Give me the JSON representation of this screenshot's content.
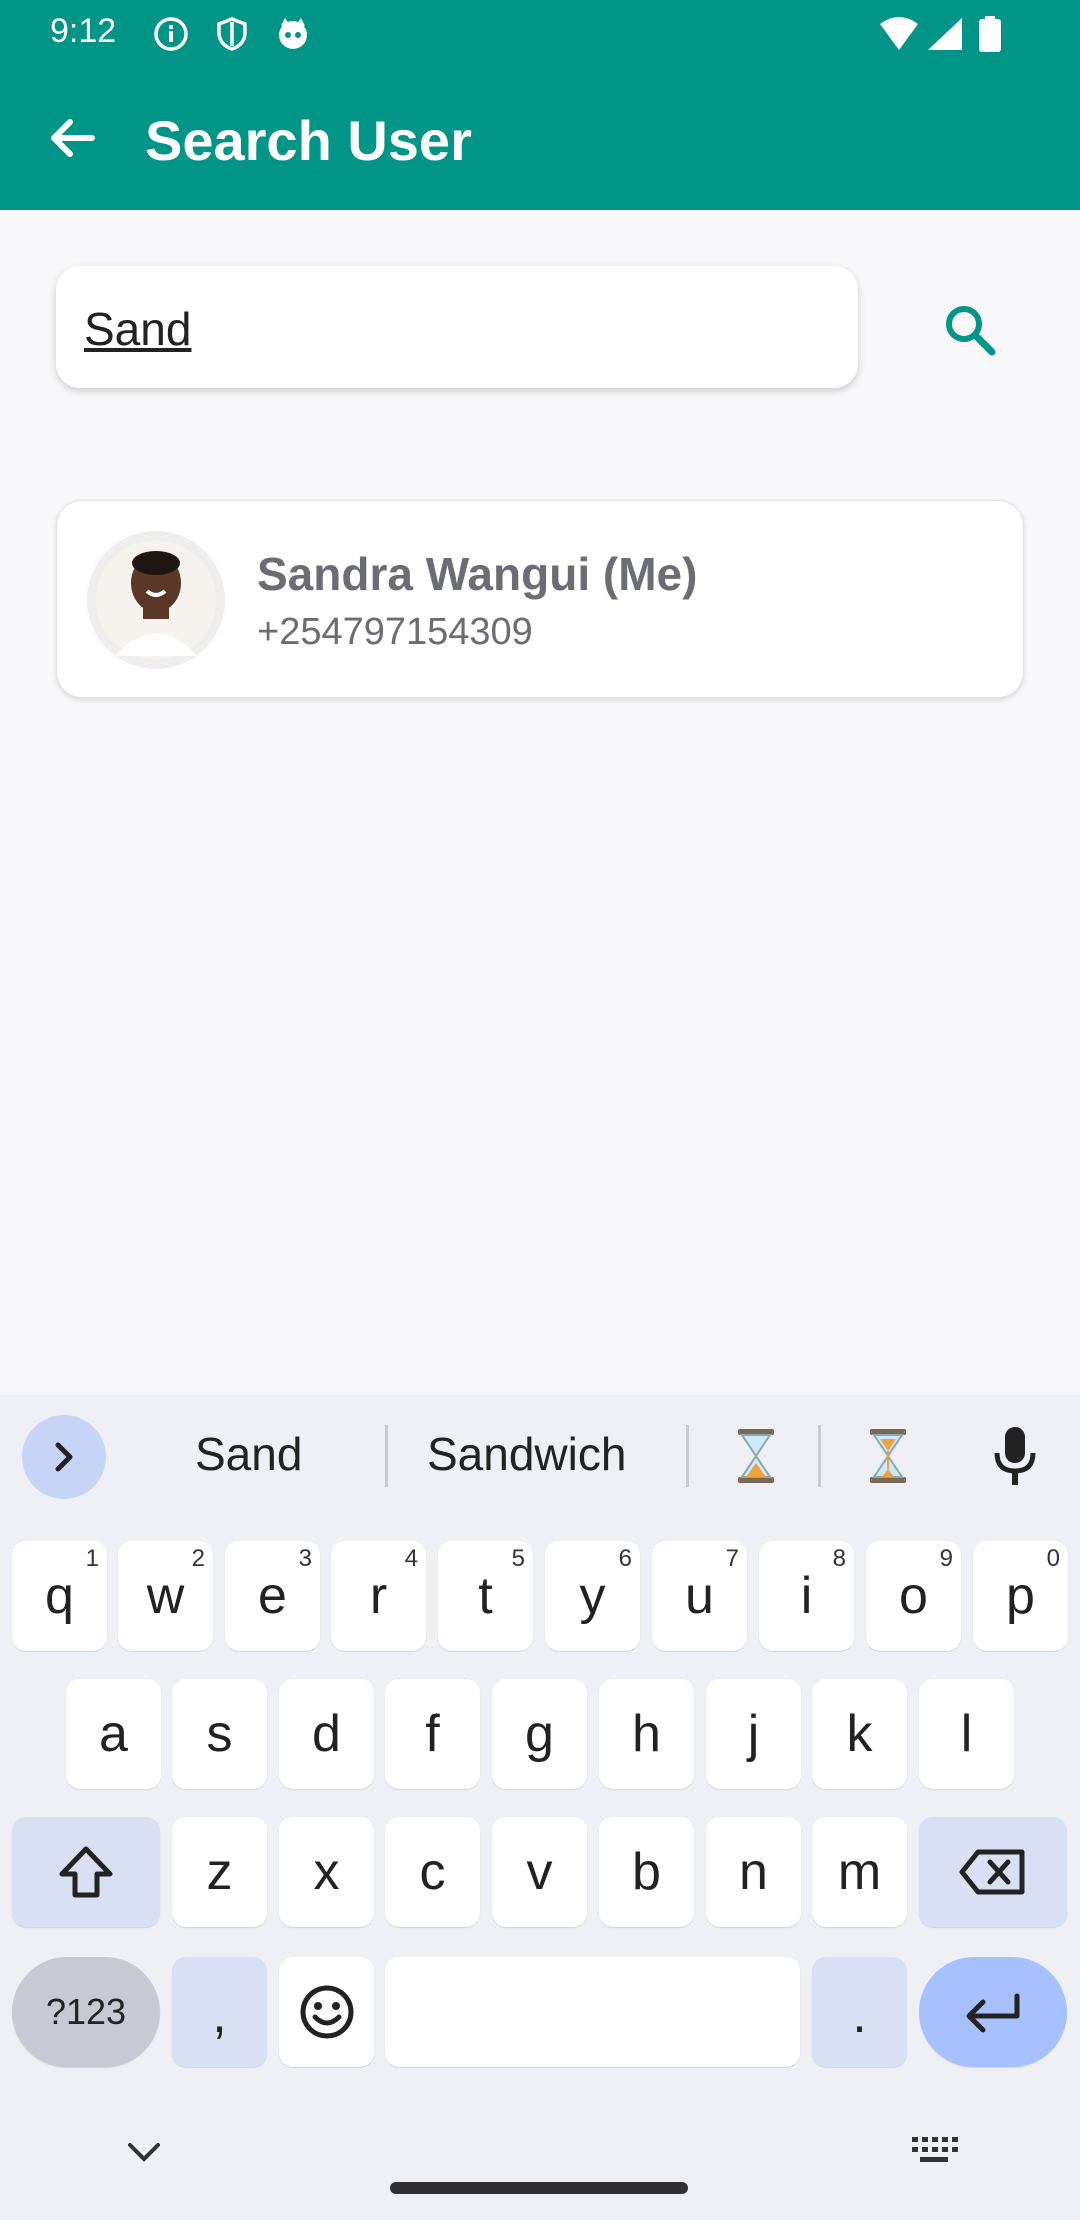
{
  "status_bar": {
    "time": "9:12"
  },
  "app_bar": {
    "title": "Search User"
  },
  "search": {
    "query": "Sand"
  },
  "results": [
    {
      "name": "Sandra Wangui (Me)",
      "phone": "+254797154309"
    }
  ],
  "keyboard": {
    "suggestions": [
      "Sand",
      "Sandwich"
    ],
    "row1": [
      {
        "key": "q",
        "hint": "1"
      },
      {
        "key": "w",
        "hint": "2"
      },
      {
        "key": "e",
        "hint": "3"
      },
      {
        "key": "r",
        "hint": "4"
      },
      {
        "key": "t",
        "hint": "5"
      },
      {
        "key": "y",
        "hint": "6"
      },
      {
        "key": "u",
        "hint": "7"
      },
      {
        "key": "i",
        "hint": "8"
      },
      {
        "key": "o",
        "hint": "9"
      },
      {
        "key": "p",
        "hint": "0"
      }
    ],
    "row2": [
      "a",
      "s",
      "d",
      "f",
      "g",
      "h",
      "j",
      "k",
      "l"
    ],
    "row3": [
      "z",
      "x",
      "c",
      "v",
      "b",
      "n",
      "m"
    ],
    "symbols_label": "?123",
    "comma": ",",
    "period": "."
  },
  "colors": {
    "primary": "#009587",
    "background": "#f8f8fa"
  }
}
